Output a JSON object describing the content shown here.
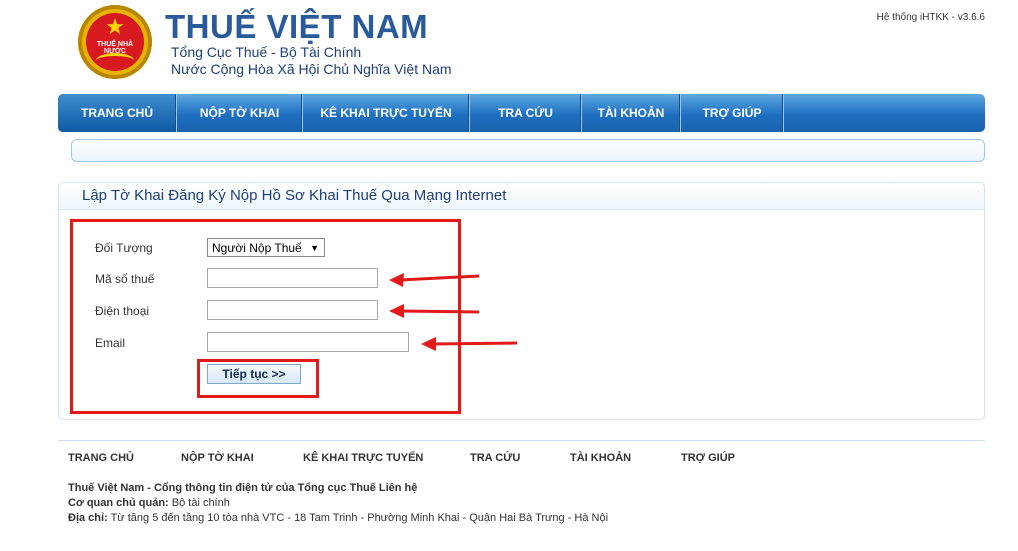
{
  "header": {
    "logo_text": "THUẾ NHÀ NƯỚC",
    "title": "THUẾ VIỆT NAM",
    "subtitle1": "Tổng Cục Thuế - Bộ Tài Chính",
    "subtitle2": "Nước Cộng Hòa Xã Hội Chủ Nghĩa Việt Nam",
    "version": "Hệ thống iHTKK - v3.6.6"
  },
  "nav": {
    "items": [
      {
        "label": "TRANG CHỦ"
      },
      {
        "label": "NỘP TỜ KHAI"
      },
      {
        "label": "KÊ KHAI TRỰC TUYẾN"
      },
      {
        "label": "TRA CỨU"
      },
      {
        "label": "TÀI KHOẢN"
      },
      {
        "label": "TRỢ GIÚP"
      }
    ]
  },
  "panel": {
    "title": "Lập Tờ Khai Đăng Ký Nộp Hồ Sơ Khai Thuế Qua Mạng Internet"
  },
  "form": {
    "doi_tuong_label": "Đối Tượng",
    "doi_tuong_value": "Người Nộp Thuế",
    "mst_label": "Mã số thuế",
    "mst_value": "",
    "phone_label": "Điện thoại",
    "phone_value": "",
    "email_label": "Email",
    "email_value": "",
    "submit_label": "Tiếp tục >>"
  },
  "footer": {
    "nav": [
      {
        "label": "TRANG CHỦ"
      },
      {
        "label": "NỘP TỜ KHAI"
      },
      {
        "label": "KÊ KHAI TRỰC TUYẾN"
      },
      {
        "label": "TRA CỨU"
      },
      {
        "label": "TÀI KHOẢN"
      },
      {
        "label": "TRỢ GIÚP"
      }
    ],
    "line1": "Thuế Việt Nam - Cổng thông tin điện tử của Tổng cục Thuế Liên hệ",
    "line2_label": "Cơ quan chủ quản:",
    "line2_value": " Bộ tài chính",
    "line3_label": "Địa chỉ:",
    "line3_value": " Từ tầng 5 đến tầng 10 tòa nhà VTC - 18 Tam Trinh - Phường Minh Khai - Quận Hai Bà Trưng - Hà Nội"
  },
  "colors": {
    "nav_blue": "#1e6fc0",
    "title_blue": "#2a5a99",
    "annotation_red": "#e21a1a"
  }
}
